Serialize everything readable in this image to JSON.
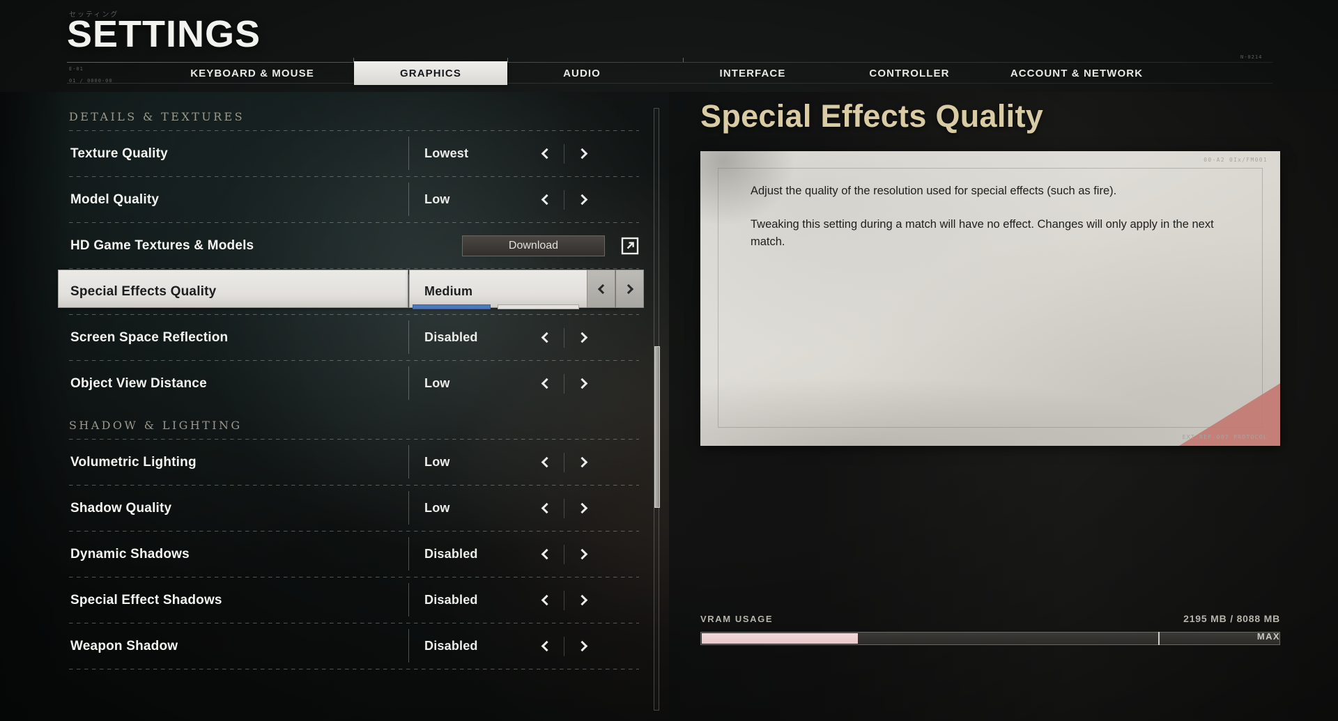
{
  "header": {
    "kana": "セッティング",
    "title": "SETTINGS",
    "mark_left": "E-01",
    "mark_right": "N-0214",
    "mark_bottom": "01 / 0000-00"
  },
  "tabs": [
    {
      "label": "KEYBOARD & MOUSE",
      "active": false
    },
    {
      "label": "GRAPHICS",
      "active": true
    },
    {
      "label": "AUDIO",
      "active": false
    },
    {
      "label": "INTERFACE",
      "active": false
    },
    {
      "label": "CONTROLLER",
      "active": false
    },
    {
      "label": "ACCOUNT & NETWORK",
      "active": false
    }
  ],
  "groups": [
    {
      "title": "DETAILS & TEXTURES",
      "rows": [
        {
          "label": "Texture Quality",
          "value": "Lowest",
          "type": "stepper"
        },
        {
          "label": "Model Quality",
          "value": "Low",
          "type": "stepper"
        },
        {
          "label": "HD Game Textures & Models",
          "value": "",
          "type": "download",
          "button_label": "Download",
          "link_icon": "external-link-icon"
        },
        {
          "label": "Special Effects Quality",
          "value": "Medium",
          "type": "stepper",
          "selected": true,
          "slider_percent": 47
        },
        {
          "label": "Screen Space Reflection",
          "value": "Disabled",
          "type": "stepper"
        },
        {
          "label": "Object View Distance",
          "value": "Low",
          "type": "stepper"
        }
      ]
    },
    {
      "title": "SHADOW & LIGHTING",
      "rows": [
        {
          "label": "Volumetric Lighting",
          "value": "Low",
          "type": "stepper"
        },
        {
          "label": "Shadow Quality",
          "value": "Low",
          "type": "stepper"
        },
        {
          "label": "Dynamic Shadows",
          "value": "Disabled",
          "type": "stepper"
        },
        {
          "label": "Special Effect Shadows",
          "value": "Disabled",
          "type": "stepper"
        },
        {
          "label": "Weapon Shadow",
          "value": "Disabled",
          "type": "stepper"
        }
      ]
    }
  ],
  "detail": {
    "title": "Special Effects Quality",
    "paragraphs": [
      "Adjust the quality of the resolution used for special effects (such as fire).",
      "Tweaking this setting during a match will have no effect. Changes will only apply in the next match."
    ],
    "paper_mark_top": "00-A2   0Ix/FM001",
    "paper_mark_bottom": "EXT.REF-007 PROTOCOL"
  },
  "vram": {
    "label": "VRAM USAGE",
    "used": "2195 MB",
    "total": "8088 MB",
    "amount_text": "2195 MB / 8088 MB",
    "max_label": "MAX",
    "used_percent": 27,
    "max_marker_percent": 79
  },
  "colors": {
    "accent_title": "#d9cca4",
    "slider_blue": "#4a79c0",
    "vram_fill": "#f0d9da",
    "paper_red": "#c4756f",
    "tab_active_bg": "#eceae6"
  },
  "icons": {
    "chevron_left": "chevron-left-icon",
    "chevron_right": "chevron-right-icon",
    "external_link": "external-link-icon"
  }
}
